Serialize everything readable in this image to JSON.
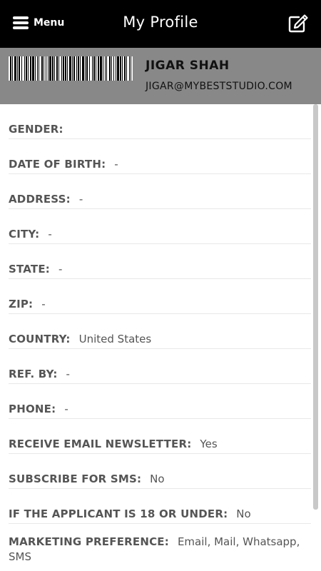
{
  "header": {
    "menu_label": "Menu",
    "title": "My Profile"
  },
  "profile": {
    "name": "JIGAR SHAH",
    "email": "JIGAR@MYBESTSTUDIO.COM"
  },
  "fields": [
    {
      "label": "GENDER:",
      "value": ""
    },
    {
      "label": "DATE OF BIRTH:",
      "value": "-"
    },
    {
      "label": "ADDRESS:",
      "value": "-"
    },
    {
      "label": "CITY:",
      "value": "-"
    },
    {
      "label": "STATE:",
      "value": "-"
    },
    {
      "label": "ZIP:",
      "value": "-"
    },
    {
      "label": "COUNTRY:",
      "value": "United States"
    },
    {
      "label": "REF. BY:",
      "value": "-"
    },
    {
      "label": "PHONE:",
      "value": "-"
    },
    {
      "label": "RECEIVE EMAIL NEWSLETTER:",
      "value": "Yes"
    },
    {
      "label": "SUBSCRIBE FOR SMS:",
      "value": "No"
    },
    {
      "label": "IF THE APPLICANT IS 18 OR UNDER:",
      "value": "No"
    },
    {
      "label": "MARKETING PREFERENCE:",
      "value": "Email, Mail, Whatsapp, SMS"
    }
  ],
  "icons": {
    "menu": "hamburger-icon",
    "edit": "edit-icon",
    "barcode": "barcode-image"
  },
  "colors": {
    "header_bg": "#000000",
    "profile_bg": "#888888",
    "label_text": "#555555"
  }
}
